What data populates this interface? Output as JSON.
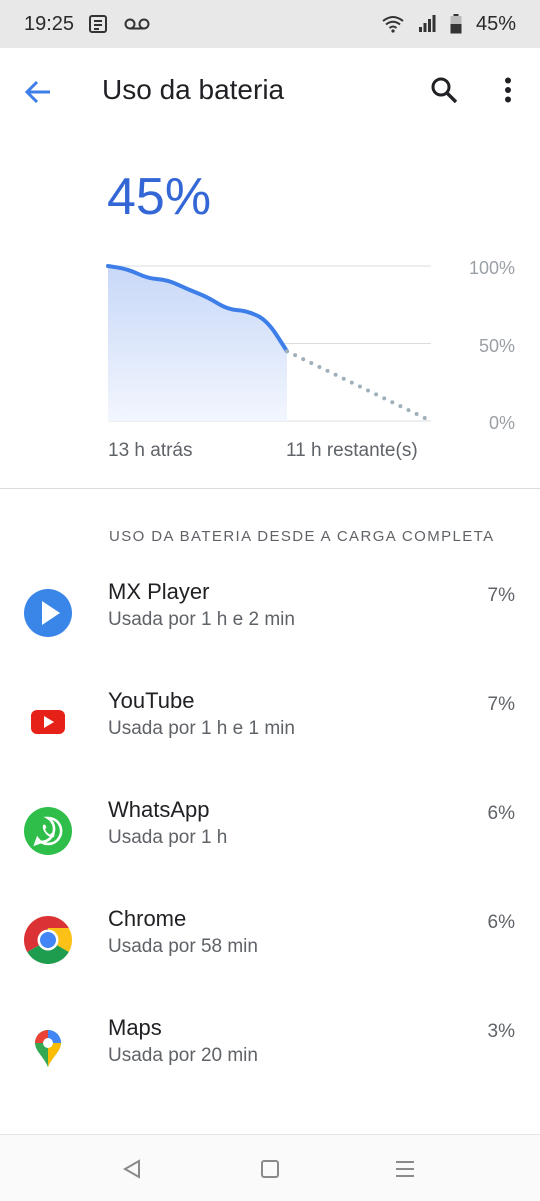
{
  "status_bar": {
    "time": "19:25",
    "battery": "45%",
    "icons": [
      "news-icon",
      "voicemail-icon",
      "wifi-icon",
      "signal-icon",
      "battery-icon"
    ]
  },
  "app_bar": {
    "title": "Uso da bateria",
    "back_icon": "arrow-back-icon",
    "search_icon": "search-icon",
    "more_icon": "more-vert-icon"
  },
  "battery": {
    "level": "45%"
  },
  "chart_data": {
    "type": "line",
    "y_ticks": [
      "100%",
      "50%",
      "0%"
    ],
    "x_labels": [
      "13 h atrás",
      "11 h restante(s)"
    ],
    "ylim": [
      0,
      100
    ],
    "series": [
      {
        "values": [
          100,
          98,
          92,
          91,
          85,
          80,
          72,
          71,
          65,
          45
        ]
      },
      {
        "values": [
          45,
          0
        ]
      }
    ],
    "colors": {
      "line": "#3d7ee8",
      "projection": "#9fb0bb",
      "grid": "#dadce0"
    }
  },
  "section": {
    "heading": "USO DA BATERIA DESDE A CARGA COMPLETA"
  },
  "apps": [
    {
      "name": "MX Player",
      "usage": "Usada por 1 h e 2 min",
      "percent": "7%",
      "icon": "mx-player-icon"
    },
    {
      "name": "YouTube",
      "usage": "Usada por 1 h e 1 min",
      "percent": "7%",
      "icon": "youtube-icon"
    },
    {
      "name": "WhatsApp",
      "usage": "Usada por 1 h",
      "percent": "6%",
      "icon": "whatsapp-icon"
    },
    {
      "name": "Chrome",
      "usage": "Usada por 58 min",
      "percent": "6%",
      "icon": "chrome-icon"
    },
    {
      "name": "Maps",
      "usage": "Usada por 20 min",
      "percent": "3%",
      "icon": "maps-icon"
    }
  ],
  "nav_bar": {
    "icons": [
      "nav-back-icon",
      "nav-home-icon",
      "nav-recents-icon"
    ]
  }
}
